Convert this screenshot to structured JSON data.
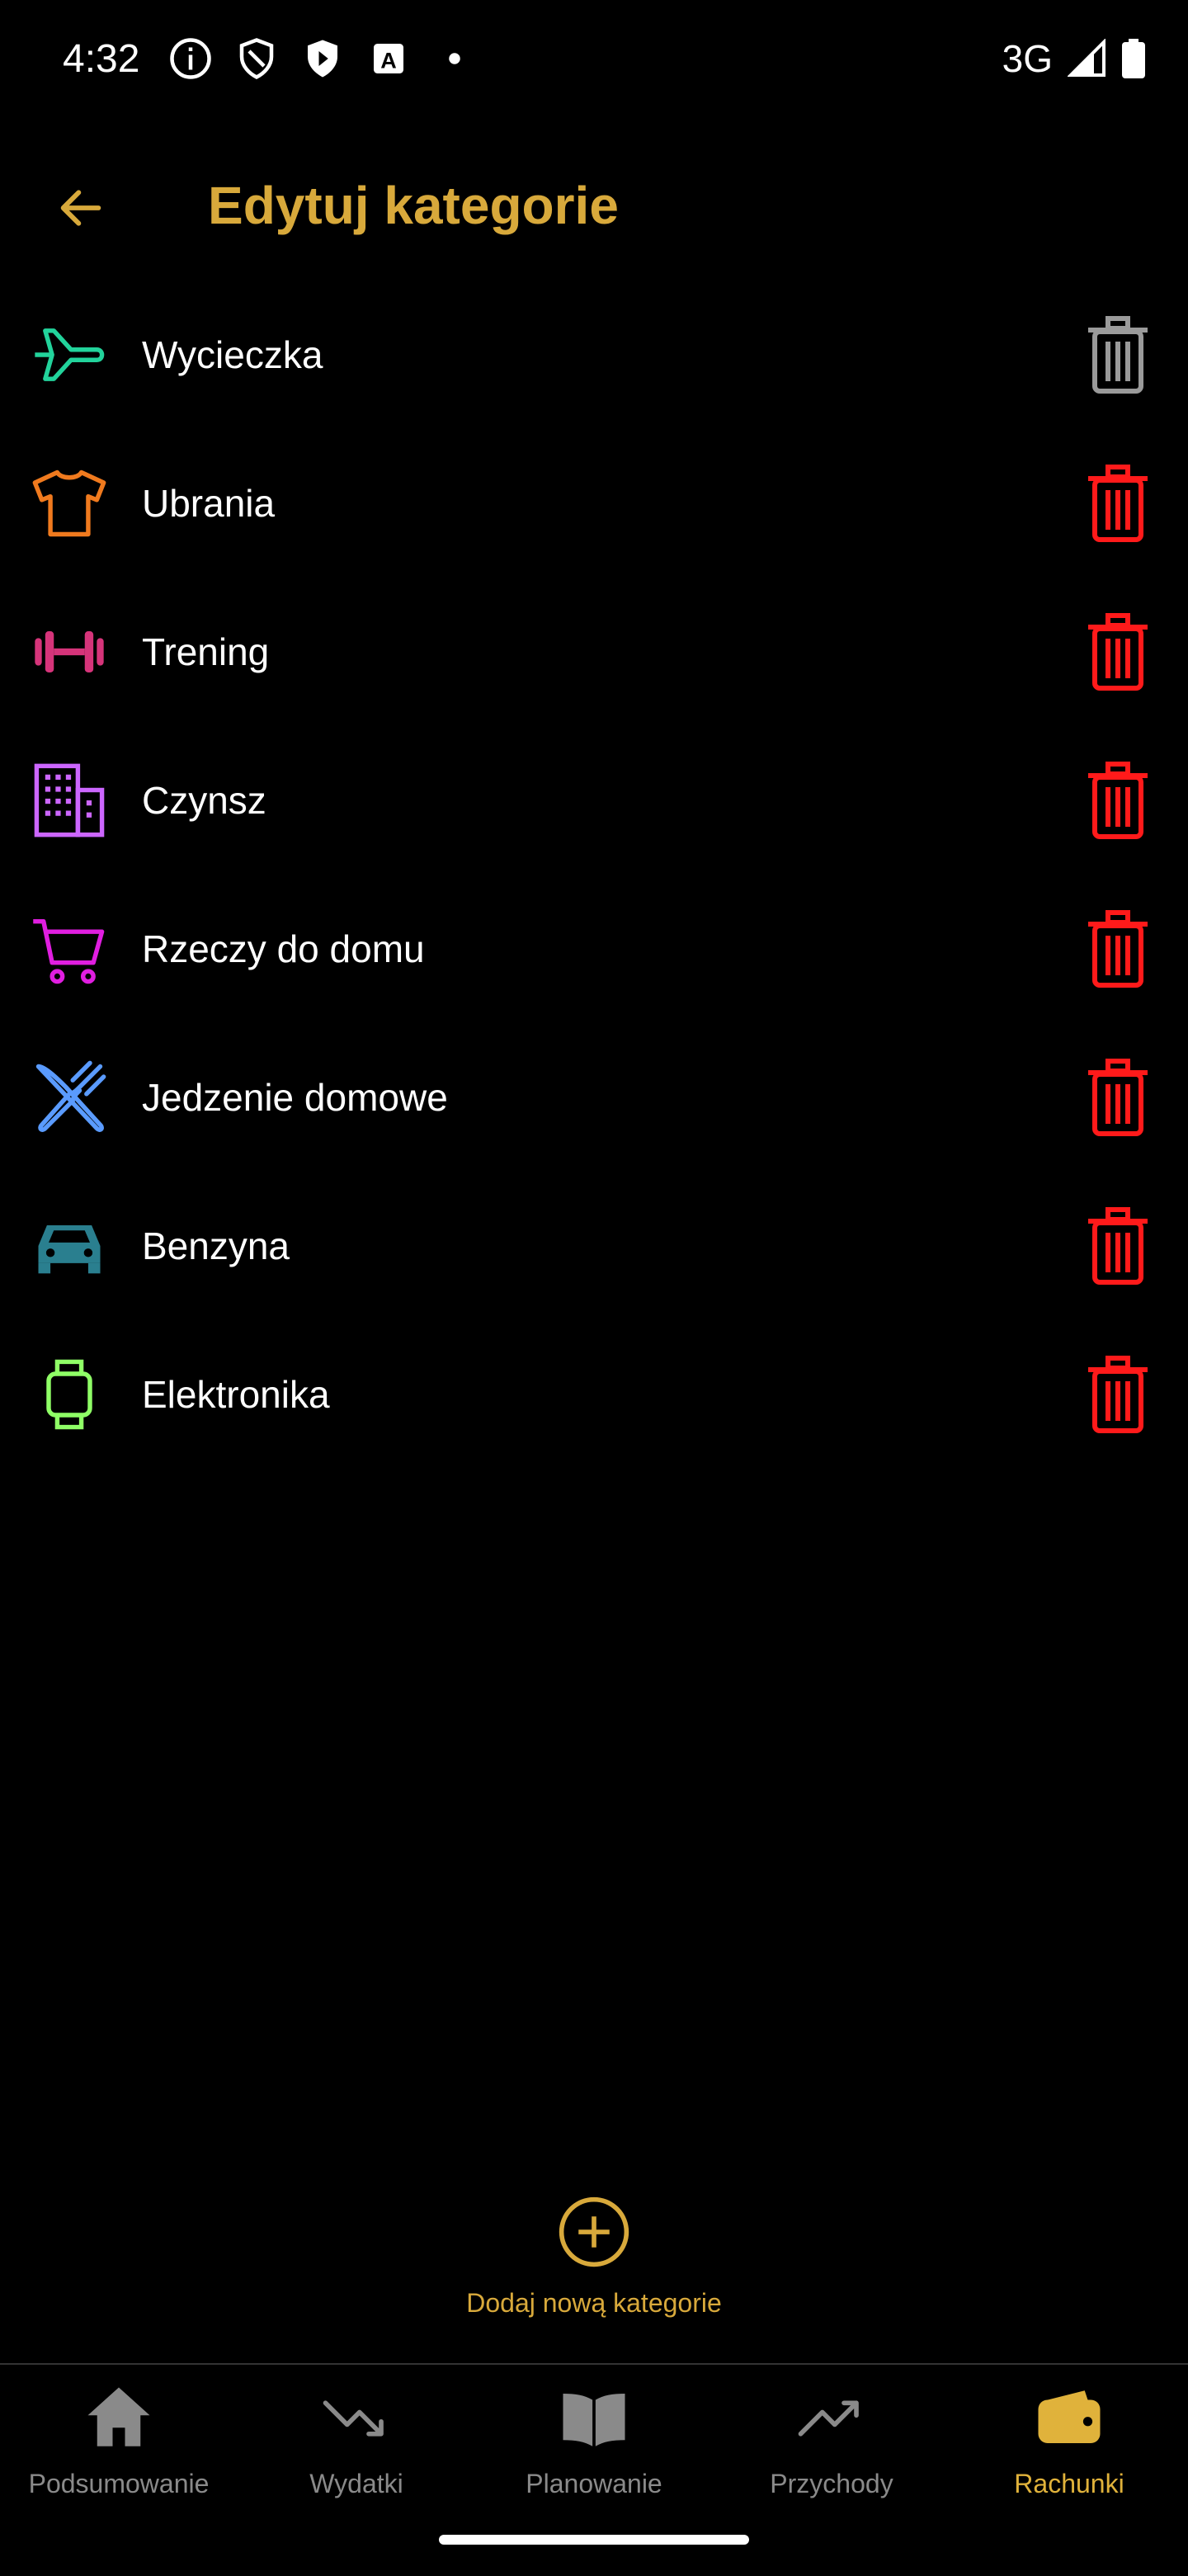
{
  "status_bar": {
    "time": "4:32",
    "network": "3G"
  },
  "header": {
    "title": "Edytuj kategorie",
    "back_icon": "arrow-left-icon"
  },
  "categories": [
    {
      "label": "Wycieczka",
      "icon": "airplane-icon",
      "color": "#22d39b",
      "delete_color": "#9a9a9a"
    },
    {
      "label": "Ubrania",
      "icon": "tshirt-icon",
      "color": "#f07a1e",
      "delete_color": "#ff1a1a"
    },
    {
      "label": "Trening",
      "icon": "dumbbell-icon",
      "color": "#d6347a",
      "delete_color": "#ff1a1a"
    },
    {
      "label": "Czynsz",
      "icon": "apartment-building-icon",
      "color": "#cc66ff",
      "delete_color": "#ff1a1a"
    },
    {
      "label": "Rzeczy do domu",
      "icon": "shopping-cart-icon",
      "color": "#e01ee0",
      "delete_color": "#ff1a1a"
    },
    {
      "label": "Jedzenie domowe",
      "icon": "fork-knife-icon",
      "color": "#5a9bff",
      "delete_color": "#ff1a1a"
    },
    {
      "label": "Benzyna",
      "icon": "car-icon",
      "color": "#2a7f8f",
      "delete_color": "#ff1a1a"
    },
    {
      "label": "Elektronika",
      "icon": "smartwatch-icon",
      "color": "#8fff66",
      "delete_color": "#ff1a1a"
    }
  ],
  "add_button": {
    "label": "Dodaj nową kategorie",
    "icon": "plus-circle-icon"
  },
  "bottom_nav": [
    {
      "label": "Podsumowanie",
      "icon": "home-icon",
      "active": false
    },
    {
      "label": "Wydatki",
      "icon": "trending-down-icon",
      "active": false
    },
    {
      "label": "Planowanie",
      "icon": "open-book-icon",
      "active": false
    },
    {
      "label": "Przychody",
      "icon": "trending-up-icon",
      "active": false
    },
    {
      "label": "Rachunki",
      "icon": "wallet-icon",
      "active": true
    }
  ],
  "colors": {
    "accent": "#d8a93b",
    "background": "#000000",
    "nav_inactive": "#8a8a8a"
  }
}
